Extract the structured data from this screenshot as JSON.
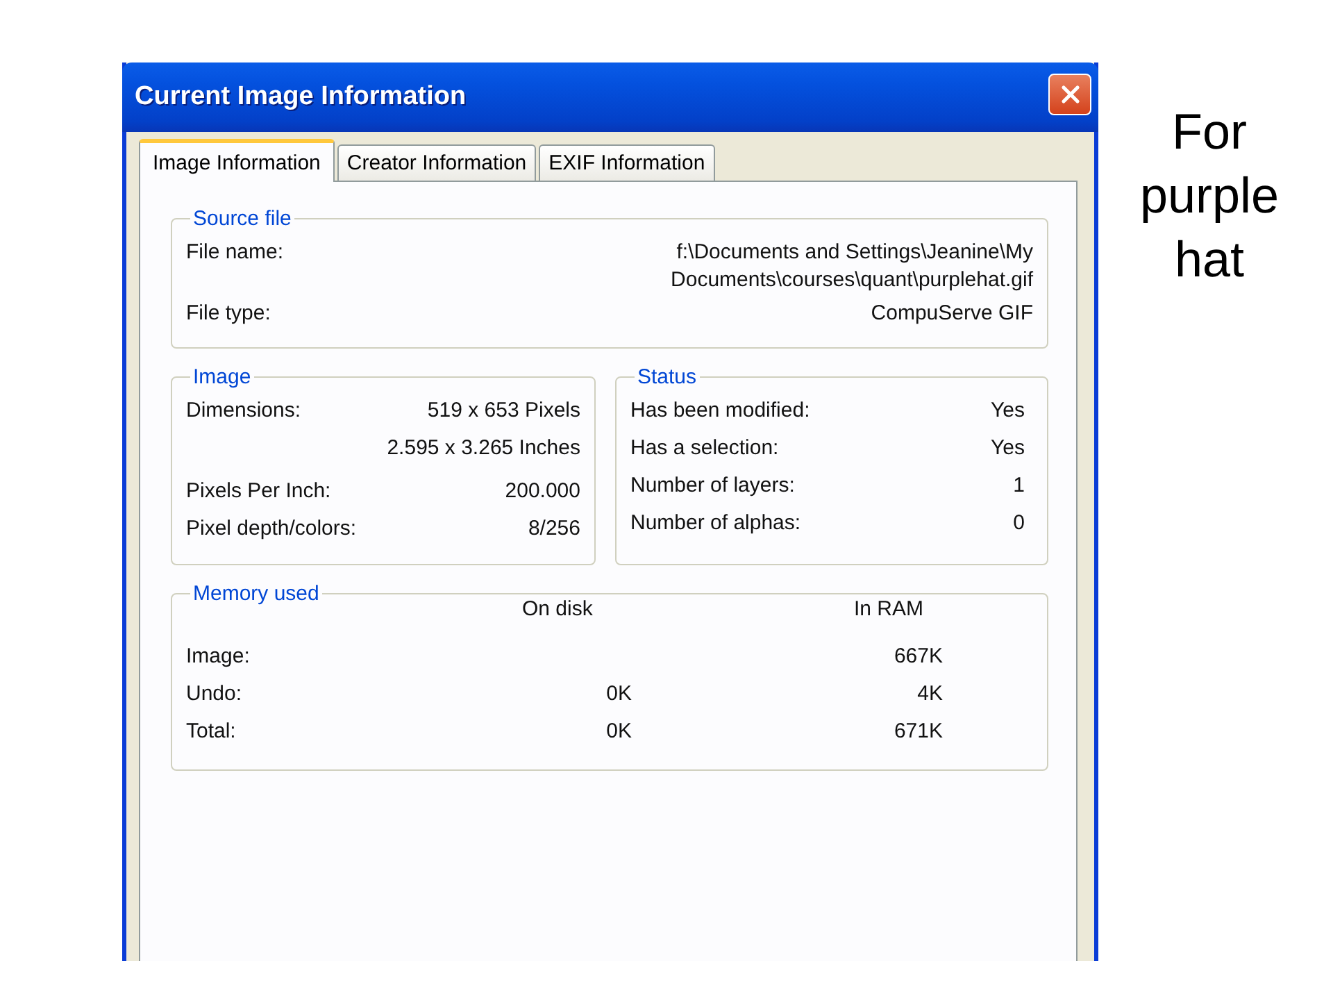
{
  "window": {
    "title": "Current Image Information"
  },
  "tabs": [
    {
      "label": "Image Information",
      "selected": true
    },
    {
      "label": "Creator Information",
      "selected": false
    },
    {
      "label": "EXIF Information",
      "selected": false
    }
  ],
  "source_file": {
    "legend": "Source file",
    "rows": [
      {
        "label": "File name:",
        "value": "f:\\Documents and Settings\\Jeanine\\My Documents\\courses\\quant\\purplehat.gif"
      },
      {
        "label": "File type:",
        "value": "CompuServe GIF"
      }
    ]
  },
  "image": {
    "legend": "Image",
    "rows": [
      {
        "label": "Dimensions:",
        "value": "519 x 653 Pixels"
      },
      {
        "value": "2.595 x 3.265 Inches"
      },
      {
        "label": "Pixels Per Inch:",
        "value": "200.000"
      },
      {
        "label": "Pixel depth/colors:",
        "value": "8/256"
      }
    ]
  },
  "status": {
    "legend": "Status",
    "rows": [
      {
        "label": "Has been modified:",
        "value": "Yes"
      },
      {
        "label": "Has a selection:",
        "value": "Yes"
      },
      {
        "label": "Number of layers:",
        "value": "1"
      },
      {
        "label": "Number of alphas:",
        "value": "0"
      }
    ]
  },
  "memory": {
    "legend": "Memory used",
    "columns": [
      "On disk",
      "In RAM"
    ],
    "rows": [
      {
        "label": "Image:",
        "on_disk": "",
        "in_ram": "667K"
      },
      {
        "label": "Undo:",
        "on_disk": "0K",
        "in_ram": "4K"
      },
      {
        "label": "Total:",
        "on_disk": "0K",
        "in_ram": "671K"
      }
    ]
  },
  "caption": "For purple hat"
}
